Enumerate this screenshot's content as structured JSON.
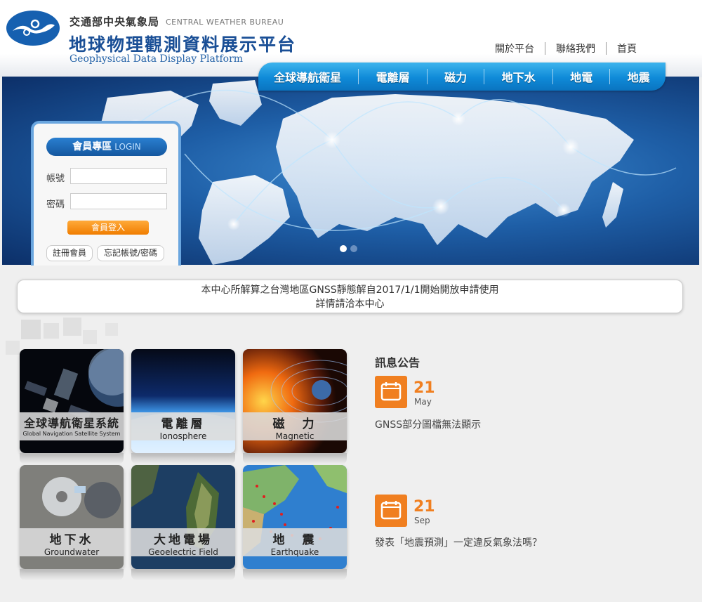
{
  "header": {
    "org_name": "交通部中央氣象局",
    "org_name_en": "CENTRAL WEATHER BUREAU",
    "site_title": "地球物理觀測資料展示平台",
    "site_title_en": "Geophysical Data Display Platform"
  },
  "top_links": [
    "關於平台",
    "聯絡我們",
    "首頁"
  ],
  "nav": [
    "全球導航衛星",
    "電離層",
    "磁力",
    "地下水",
    "地電",
    "地震"
  ],
  "login": {
    "title": "會員專區",
    "title_en": "LOGIN",
    "account_label": "帳號",
    "password_label": "密碼",
    "login_button": "會員登入",
    "register_button": "註冊會員",
    "forgot_button": "忘記帳號/密碼"
  },
  "notice": {
    "line1": "本中心所解算之台灣地區GNSS靜態解自2017/1/1開始開放申請使用",
    "line2": "詳情請洽本中心"
  },
  "tiles": [
    {
      "zh": "全球導航衛星系統",
      "en": "Global Navigation Satellite System"
    },
    {
      "zh": "電離層",
      "en": "Ionosphere"
    },
    {
      "zh": "磁　力",
      "en": "Magnetic"
    },
    {
      "zh": "地下水",
      "en": "Groundwater"
    },
    {
      "zh": "大地電場",
      "en": "Geoelectric Field"
    },
    {
      "zh": "地　震",
      "en": "Earthquake"
    }
  ],
  "news": {
    "title": "訊息公告",
    "items": [
      {
        "day": "21",
        "month": "May",
        "text": "GNSS部分圖檔無法顯示"
      },
      {
        "day": "21",
        "month": "Sep",
        "text": "發表「地震預測」一定違反氣象法嗎？"
      }
    ]
  },
  "colors": {
    "brand_blue": "#1a4f96",
    "nav_blue": "#0f8ad8",
    "accent_orange": "#f07f20"
  }
}
